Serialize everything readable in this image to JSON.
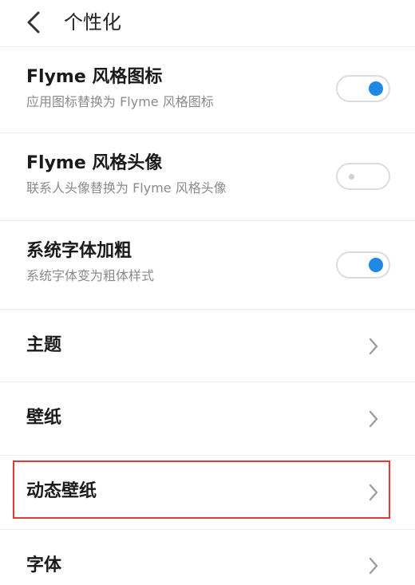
{
  "header": {
    "title": "个性化",
    "back_icon": "chevron-left-icon"
  },
  "toggle_items": [
    {
      "title": "Flyme 风格图标",
      "subtitle": "应用图标替换为 Flyme 风格图标",
      "on": true
    },
    {
      "title": "Flyme 风格头像",
      "subtitle": "联系人头像替换为 Flyme 风格头像",
      "on": false
    },
    {
      "title": "系统字体加粗",
      "subtitle": "系统字体变为粗体样式",
      "on": true
    }
  ],
  "nav_items": [
    {
      "title": "主题",
      "icon": "chevron-right-icon"
    },
    {
      "title": "壁纸",
      "icon": "chevron-right-icon"
    },
    {
      "title": "动态壁纸",
      "icon": "chevron-right-icon",
      "highlighted": true
    },
    {
      "title": "字体",
      "icon": "chevron-right-icon"
    }
  ],
  "colors": {
    "accent": "#1e88e5",
    "highlight_border": "#e53935",
    "divider": "#ececec",
    "subtitle": "#8a8a8a"
  }
}
